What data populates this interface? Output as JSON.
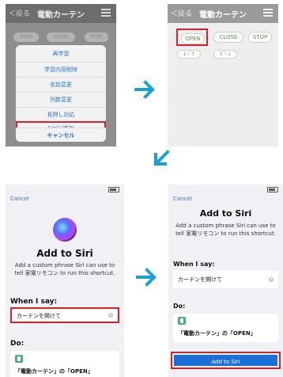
{
  "screen1": {
    "nav": {
      "back": "＜戻る",
      "title": "電動カーテン"
    },
    "bg_buttons": [
      "OPEN",
      "CLOSE",
      "STOP"
    ],
    "menu": [
      "再学習",
      "学習内容削除",
      "名前変更",
      "列数変更",
      "長押し対応",
      "Siriに追加"
    ],
    "cancel": "キャンセル",
    "highlighted_item": "Siriに追加"
  },
  "screen2": {
    "nav": {
      "back": "＜戻る",
      "title": "電動カーテン"
    },
    "buttons": [
      "OPEN",
      "CLOSE",
      "STOP"
    ],
    "small_buttons": [
      "↓／↑",
      "↑＼↓"
    ],
    "highlighted_button": "OPEN"
  },
  "siri_initial": {
    "cancel": "Cancel",
    "title": "Add to Siri",
    "description": "Add a custom phrase Siri can use to tell 家電リモコン to run this shortcut.",
    "when_label": "When I say:",
    "phrase": "カーテンを開けて",
    "do_label": "Do:",
    "action": "「電動カーテン」の「OPEN」"
  },
  "siri_confirm": {
    "cancel": "Cancel",
    "title": "Add to Siri",
    "description": "Add a custom phrase Siri can use to tell 家電リモコン to run this shortcut.",
    "when_label": "When I say:",
    "phrase": "カーテンを開けて",
    "do_label": "Do:",
    "action": "「電動カーテン」の「OPEN」",
    "add_button": "Add to Siri"
  },
  "colors": {
    "highlight": "#d6232a",
    "arrow": "#1aa0d8",
    "link": "#2a74d6",
    "siri_button": "#1b6fd9"
  },
  "icons": [
    "arrow-right-icon",
    "arrow-down-left-icon",
    "arrow-right-icon",
    "siri-orb-icon",
    "home-icon",
    "clear-icon",
    "menu-icon",
    "back-chevron-icon"
  ]
}
